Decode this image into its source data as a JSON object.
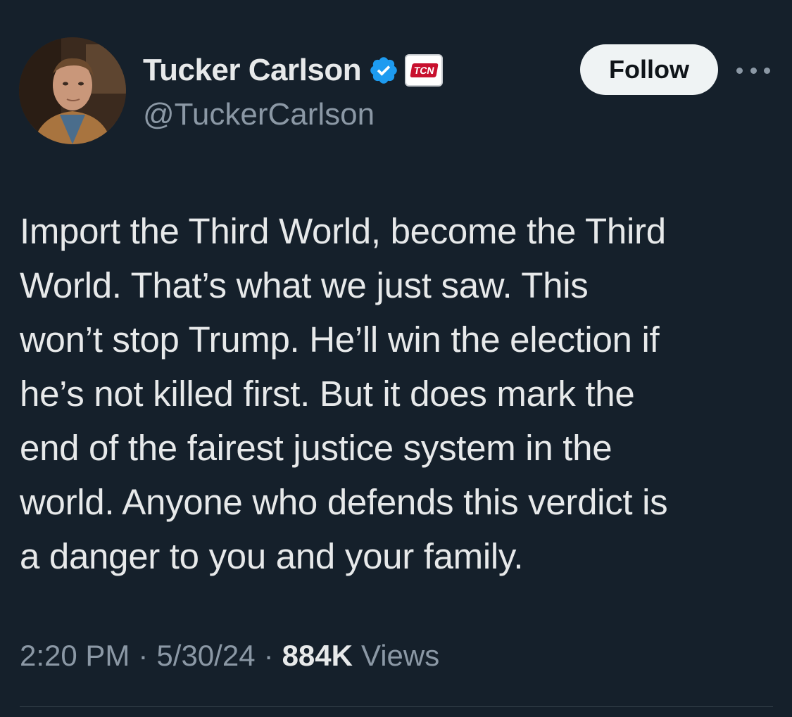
{
  "author": {
    "display_name": "Tucker Carlson",
    "handle": "@TuckerCarlson",
    "verified": true,
    "verified_color": "#1d9bf0",
    "affiliate_badge_text": "TCN",
    "affiliate_badge_color": "#c8102e",
    "avatar_icon": "profile-photo"
  },
  "actions": {
    "follow_label": "Follow",
    "more_icon": "more-horizontal-icon"
  },
  "tweet": {
    "text": "Import the Third World, become the Third\nWorld. That’s what we just saw. This\nwon’t stop Trump. He’ll win the election if\nhe’s not killed first. But it does mark the\nend of the fairest justice system in the\nworld. Anyone who defends this verdict is\na danger to you and your family."
  },
  "meta": {
    "time": "2:20 PM",
    "separator": "·",
    "date": "5/30/24",
    "views_count": "884K",
    "views_label": "Views"
  },
  "theme": {
    "background": "#15202b",
    "text_primary": "#e7e9ea",
    "text_secondary": "#8b98a5"
  }
}
